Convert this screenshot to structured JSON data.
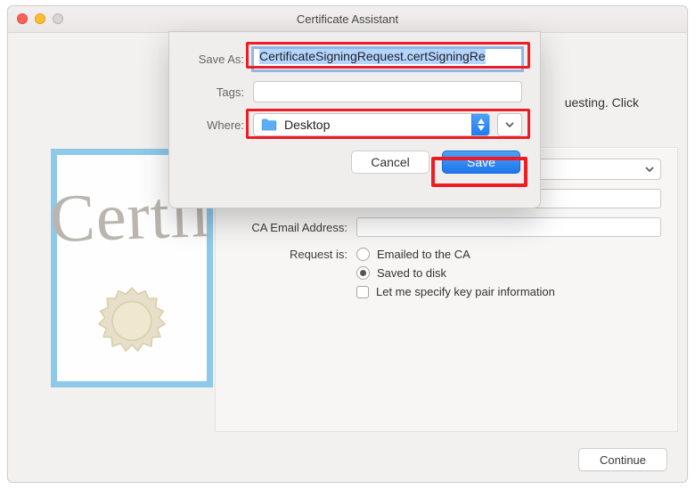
{
  "window": {
    "title": "Certificate Assistant"
  },
  "peek_text": "uesting. Click",
  "cert_art": {
    "script": "Certif"
  },
  "form": {
    "ca_email_label": "CA Email Address:",
    "request_is_label": "Request is:",
    "option_emailed": "Emailed to the CA",
    "option_saved": "Saved to disk",
    "option_keypair": "Let me specify key pair information"
  },
  "continue_label": "Continue",
  "sheet": {
    "save_as_label": "Save As:",
    "save_as_value": "CertificateSigningRequest.certSigningRe",
    "tags_label": "Tags:",
    "where_label": "Where:",
    "where_value": "Desktop",
    "cancel_label": "Cancel",
    "save_label": "Save"
  }
}
